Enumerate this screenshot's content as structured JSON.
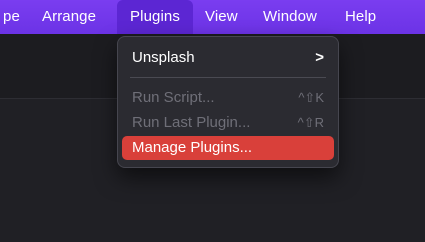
{
  "menubar": {
    "items": [
      {
        "label": "pe"
      },
      {
        "label": "Arrange"
      },
      {
        "label": "Plugins"
      },
      {
        "label": "View"
      },
      {
        "label": "Window"
      },
      {
        "label": "Help"
      }
    ]
  },
  "plugins_menu": {
    "unsplash": {
      "label": "Unsplash",
      "chevron": ">"
    },
    "run_script": {
      "label": "Run Script...",
      "shortcut": "^⇧K"
    },
    "run_last_plugin": {
      "label": "Run Last Plugin...",
      "shortcut": "^⇧R"
    },
    "manage_plugins": {
      "label": "Manage Plugins..."
    }
  },
  "colors": {
    "menubar": "#6c33e6",
    "highlight": "#d9403a",
    "menu_bg": "#2b2b31"
  }
}
